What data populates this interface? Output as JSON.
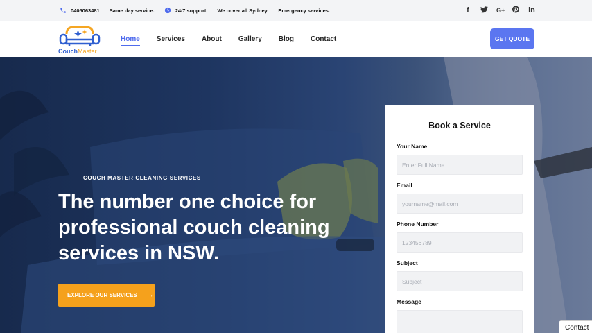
{
  "topbar": {
    "phone": "0405063481",
    "phone_note": "Same day service.",
    "support": "24/7 support.",
    "coverage": "We cover all Sydney.",
    "emergency": "Emergency services.",
    "socials": [
      "facebook-icon",
      "twitter-icon",
      "google-plus-icon",
      "pinterest-icon",
      "linkedin-icon"
    ]
  },
  "logo": {
    "part1": "Couch",
    "part2": "Master"
  },
  "nav": {
    "items": [
      "Home",
      "Services",
      "About",
      "Gallery",
      "Blog",
      "Contact"
    ],
    "active": "Home",
    "quote_button": "GET QUOTE"
  },
  "hero": {
    "tagline": "COUCH MASTER CLEANING SERVICES",
    "title": "The number one choice for professional couch cleaning services in NSW.",
    "button": "EXPLORE OUR SERVICES"
  },
  "form": {
    "title": "Book a Service",
    "name_label": "Your Name",
    "name_placeholder": "Enter Full Name",
    "email_label": "Email",
    "email_placeholder": "yourname@mail.com",
    "phone_label": "Phone Number",
    "phone_placeholder": "123456789",
    "subject_label": "Subject",
    "subject_placeholder": "Subject",
    "message_label": "Message"
  },
  "contact_tab": "Contact",
  "colors": {
    "accent": "#4f6bed",
    "cta": "#f5a11c",
    "hero_dark": "#172a4d"
  }
}
